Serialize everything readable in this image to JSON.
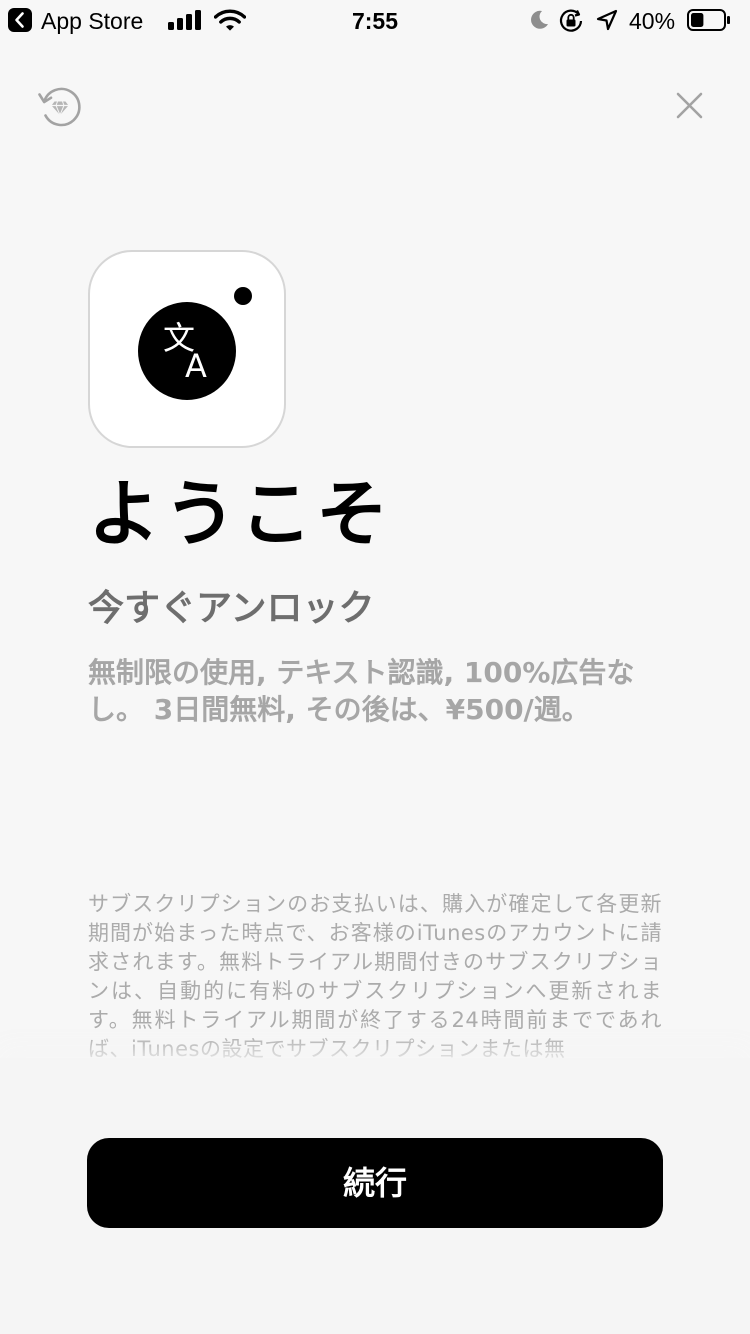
{
  "status_bar": {
    "back_app_label": "App Store",
    "time": "7:55",
    "battery_percent": "40%",
    "battery_level": 0.4,
    "icons": [
      "back-chevron-icon",
      "signal-icon",
      "wifi-icon",
      "moon-icon",
      "orientation-lock-icon",
      "location-icon",
      "battery-icon"
    ]
  },
  "top_bar": {
    "restore_icon": "restore-purchase-icon",
    "close_icon": "close-icon"
  },
  "app_icon": {
    "icon": "translate-camera-icon",
    "glyph_kanji": "文",
    "glyph_latin": "A"
  },
  "main": {
    "title": "ようこそ",
    "subtitle": "今すぐアンロック",
    "features": "無制限の使用, テキスト認識, 100%広告なし。 3日間無料, その後は、¥500/週。",
    "legal": "サブスクリプションのお支払いは、購入が確定して各更新期間が始まった時点で、お客様のiTunesのアカウントに請求されます。無料トライアル期間付きのサブスクリプションは、自動的に有料のサブスクリプションへ更新されます。無料トライアル期間が終了する24時間前までであれば、iTunesの設定でサブスクリプションまたは無"
  },
  "actions": {
    "continue_label": "続行"
  },
  "colors": {
    "background": "#f7f7f7",
    "primary_button": "#000000",
    "subtitle_text": "#6e6e6e",
    "features_text": "#a6a6a6",
    "legal_text": "#ababab"
  }
}
